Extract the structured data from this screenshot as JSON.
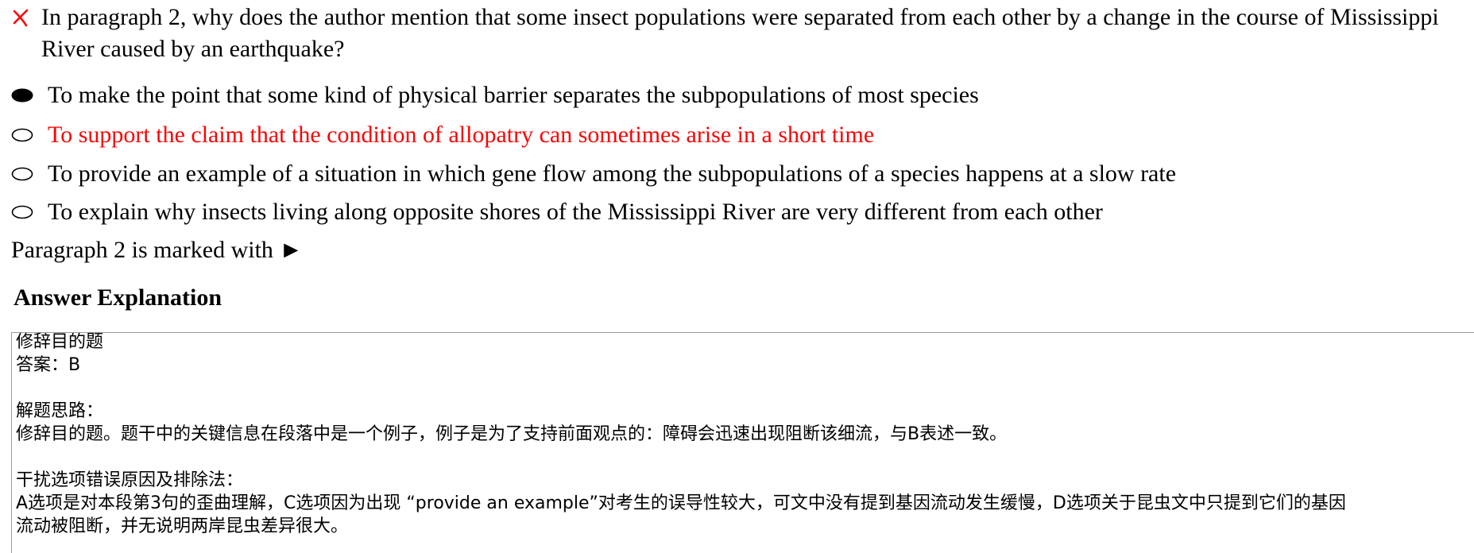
{
  "question": {
    "status_icon": "wrong-x-icon",
    "status_color": "#ff0000",
    "text": "In paragraph 2, why does the author mention that some insect populations were separated from each other by a change in the course of Mississippi River caused by an earthquake?"
  },
  "options": [
    {
      "label": "To make the point that some kind of physical barrier separates the subpopulations of most species",
      "selected": true,
      "correct": false
    },
    {
      "label": "To support the claim that the condition of allopatry can sometimes arise in a short time",
      "selected": false,
      "correct": true
    },
    {
      "label": "To provide an example of a situation in which gene flow among the subpopulations of a species happens at a slow rate",
      "selected": false,
      "correct": false
    },
    {
      "label": "To explain why insects living along opposite shores of the Mississippi River are very different from each other",
      "selected": false,
      "correct": false
    }
  ],
  "marked_note": "Paragraph 2 is marked with ►",
  "explanation": {
    "title": "Answer Explanation",
    "lines": [
      "修辞目的题",
      "答案：B",
      "",
      "解题思路：",
      "修辞目的题。题干中的关键信息在段落中是一个例子，例子是为了支持前面观点的：障碍会迅速出现阻断该细流，与B表述一致。",
      "",
      "干扰选项错误原因及排除法：",
      "A选项是对本段第3句的歪曲理解，C选项因为出现 “provide an example”对考生的误导性较大，可文中没有提到基因流动发生缓慢，D选项关于昆虫文中只提到它们的基因",
      "流动被阻断，并无说明两岸昆虫差异很大。"
    ]
  },
  "colors": {
    "correct_answer": "#ff0000",
    "text": "#000000",
    "box_border": "#9a9a9a"
  }
}
